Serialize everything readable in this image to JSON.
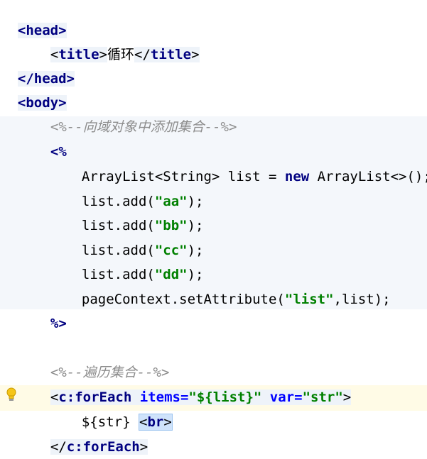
{
  "head_open": "head",
  "title_tag": "title",
  "title_text": "循环",
  "head_close": "head",
  "body_open": "body",
  "comment1": "<%--向域对象中添加集合--%>",
  "scriptlet_open": "<%",
  "code": {
    "l1_type": "ArrayList<String>",
    "l1_var": " list = ",
    "l1_new": "new",
    "l1_rest": " ArrayList<>();",
    "call_prefix": "list.add(",
    "call_suffix": ");",
    "items": [
      "\"aa\"",
      "\"bb\"",
      "\"cc\"",
      "\"dd\""
    ],
    "set_prefix": "pageContext.setAttribute(",
    "set_str": "\"list\"",
    "set_suffix": ",list);"
  },
  "scriptlet_close": "%>",
  "comment2": "<%--遍历集合--%>",
  "foreach": {
    "tag": "c:forEach",
    "items_attr": "items=",
    "items_val": "\"${list}\"",
    "var_attr": "var=",
    "var_val": "\"str\"",
    "body_el": "${str}",
    "br_tag": "br"
  },
  "icon": "lightbulb-icon"
}
